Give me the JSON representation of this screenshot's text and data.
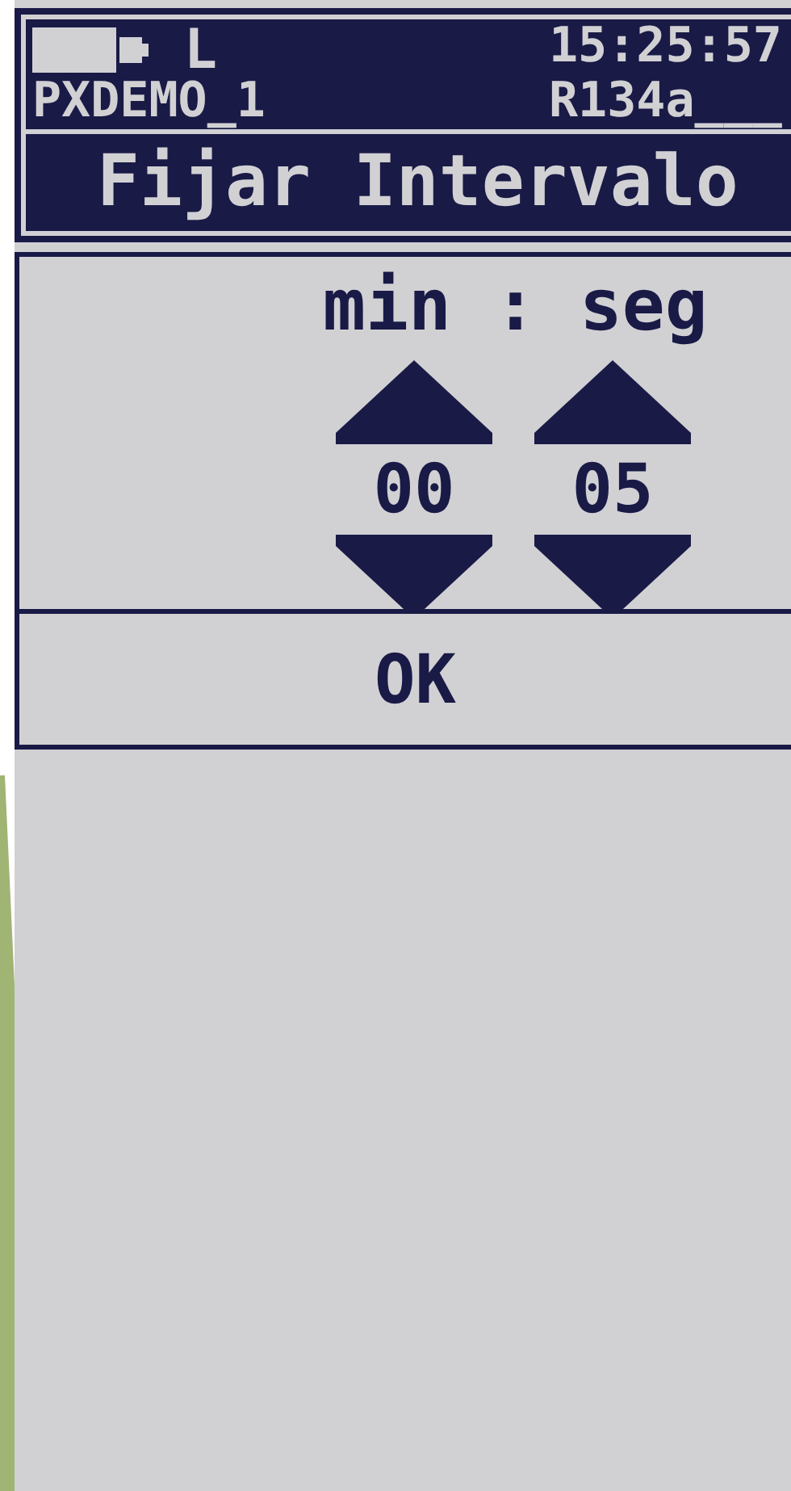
{
  "status": {
    "indicator": "L",
    "time": "15:25:57",
    "device": "PXDEMO_1",
    "refrigerant": "R134a___"
  },
  "title": "Fijar Intervalo",
  "units": "min : seg",
  "spinners": [
    {
      "value": "00"
    },
    {
      "value": "05"
    }
  ],
  "ok_button": "OK"
}
